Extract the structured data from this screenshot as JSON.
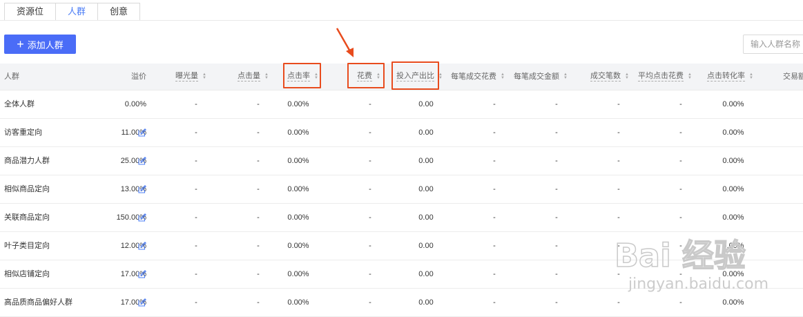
{
  "tabs": [
    "资源位",
    "人群",
    "创意"
  ],
  "active_tab": "人群",
  "toolbar": {
    "add_label": "添加人群"
  },
  "search": {
    "placeholder": "输入人群名称"
  },
  "columns": [
    "人群",
    "溢价",
    "曝光量",
    "点击量",
    "点击率",
    "花费",
    "投入产出比",
    "每笔成交花费",
    "每笔成交金额",
    "成交笔数",
    "平均点击花费",
    "点击转化率",
    "交易额"
  ],
  "rows": [
    {
      "name": "全体人群",
      "premium": "0.00%",
      "editable": false,
      "ctr": "0.00%",
      "roi": "0.00",
      "cvr": "0.00%"
    },
    {
      "name": "访客重定向",
      "premium": "11.00%",
      "editable": true,
      "ctr": "0.00%",
      "roi": "0.00",
      "cvr": "0.00%"
    },
    {
      "name": "商品潜力人群",
      "premium": "25.00%",
      "editable": true,
      "ctr": "0.00%",
      "roi": "0.00",
      "cvr": "0.00%"
    },
    {
      "name": "相似商品定向",
      "premium": "13.00%",
      "editable": true,
      "ctr": "0.00%",
      "roi": "0.00",
      "cvr": "0.00%"
    },
    {
      "name": "关联商品定向",
      "premium": "150.00%",
      "editable": true,
      "ctr": "0.00%",
      "roi": "0.00",
      "cvr": "0.00%"
    },
    {
      "name": "叶子类目定向",
      "premium": "12.00%",
      "editable": true,
      "ctr": "0.00%",
      "roi": "0.00",
      "cvr": "0.00%"
    },
    {
      "name": "相似店铺定向",
      "premium": "17.00%",
      "editable": true,
      "ctr": "0.00%",
      "roi": "0.00",
      "cvr": "0.00%"
    },
    {
      "name": "高品质商品偏好人群",
      "premium": "17.00%",
      "editable": true,
      "ctr": "0.00%",
      "roi": "0.00",
      "cvr": "0.00%"
    }
  ],
  "empty_value": "-",
  "watermark": {
    "brand": "Bai  经验",
    "url": "jingyan.baidu.com"
  },
  "colors": {
    "accent": "#4a6cf7",
    "highlight": "#e84b1d",
    "header_bg": "#f3f4f6"
  }
}
